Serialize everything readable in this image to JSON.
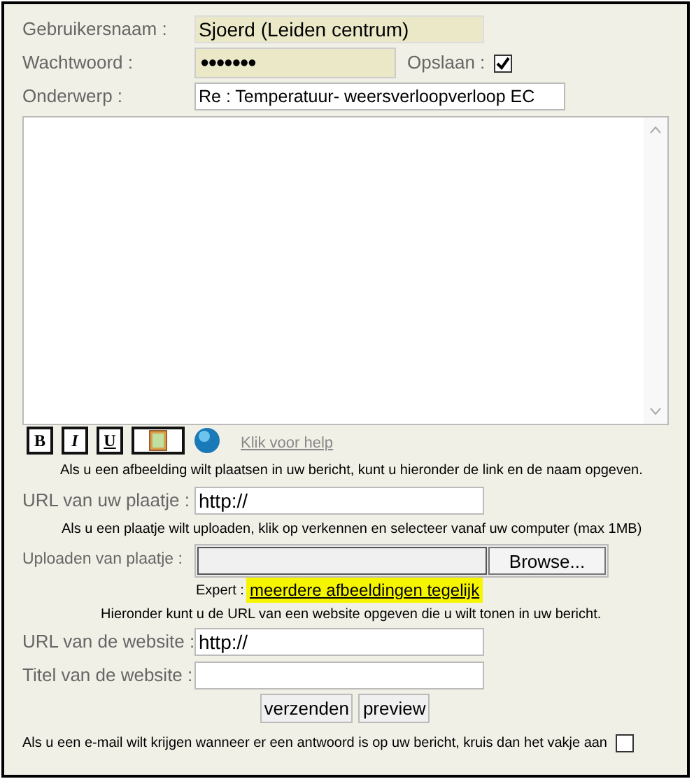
{
  "login": {
    "username_label": "Gebruikersnaam :",
    "username": "Sjoerd (Leiden centrum)",
    "password_label": "Wachtwoord :",
    "password": "●●●●●●●",
    "save_label": "Opslaan :",
    "save_checked": true
  },
  "subject": {
    "label": "Onderwerp :",
    "value": "Re : Temperatuur- weersverloopverloop EC"
  },
  "toolbar": {
    "buttons": [
      {
        "kind": "bold",
        "label": "B"
      },
      {
        "kind": "italic",
        "label": "I"
      },
      {
        "kind": "underline",
        "label": "U"
      },
      {
        "kind": "image"
      },
      {
        "kind": "globe"
      }
    ],
    "help_link": "Klik voor help"
  },
  "image_note": "Als u een afbeelding wilt plaatsen in uw bericht, kunt u hieronder de link en de naam opgeven.",
  "image_url": {
    "label": "URL van uw plaatje :",
    "value": "http://"
  },
  "upload_note": "Als u een plaatje wilt uploaden, klik op verkennen en selecteer vanaf uw computer (max 1MB)",
  "upload": {
    "label": "Uploaden van plaatje :",
    "button": "Browse...",
    "expert_label": "Expert :",
    "expert_link": "meerdere afbeeldingen tegelijk"
  },
  "website_note": "Hieronder kunt u de URL van een website opgeven die u wilt tonen in uw bericht.",
  "website_url": {
    "label": "URL van de website :",
    "value": "http://"
  },
  "website_title": {
    "label": "Titel van de website :"
  },
  "buttons": [
    "verzenden",
    "preview"
  ],
  "notify": {
    "label": "Als u een e-mail wilt krijgen wanneer er een antwoord is op uw bericht, kruis dan het vakje aan",
    "checked": false
  }
}
